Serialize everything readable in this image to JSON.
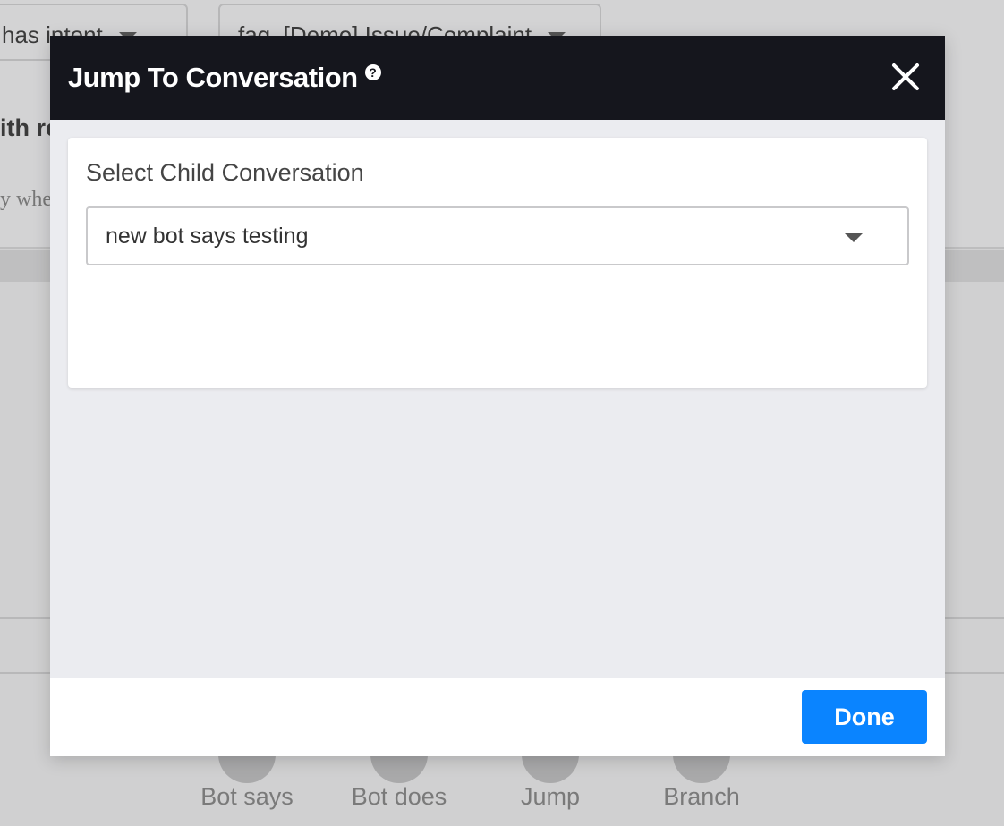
{
  "background": {
    "selects": [
      {
        "value": "has intent"
      },
      {
        "value": "faq_[Demo] Issue/Complaint"
      }
    ],
    "text_with": "ith re",
    "text_when": "y whe",
    "actions": [
      {
        "label": "Bot says"
      },
      {
        "label": "Bot does"
      },
      {
        "label": "Jump"
      },
      {
        "label": "Branch"
      }
    ]
  },
  "modal": {
    "title": "Jump To Conversation",
    "help_glyph": "?",
    "field_label": "Select Child Conversation",
    "selected_value": "new bot says testing",
    "done_label": "Done"
  },
  "colors": {
    "header_bg": "#15161d",
    "primary": "#0a84ff",
    "overlay_bg": "#d0d0d1"
  }
}
